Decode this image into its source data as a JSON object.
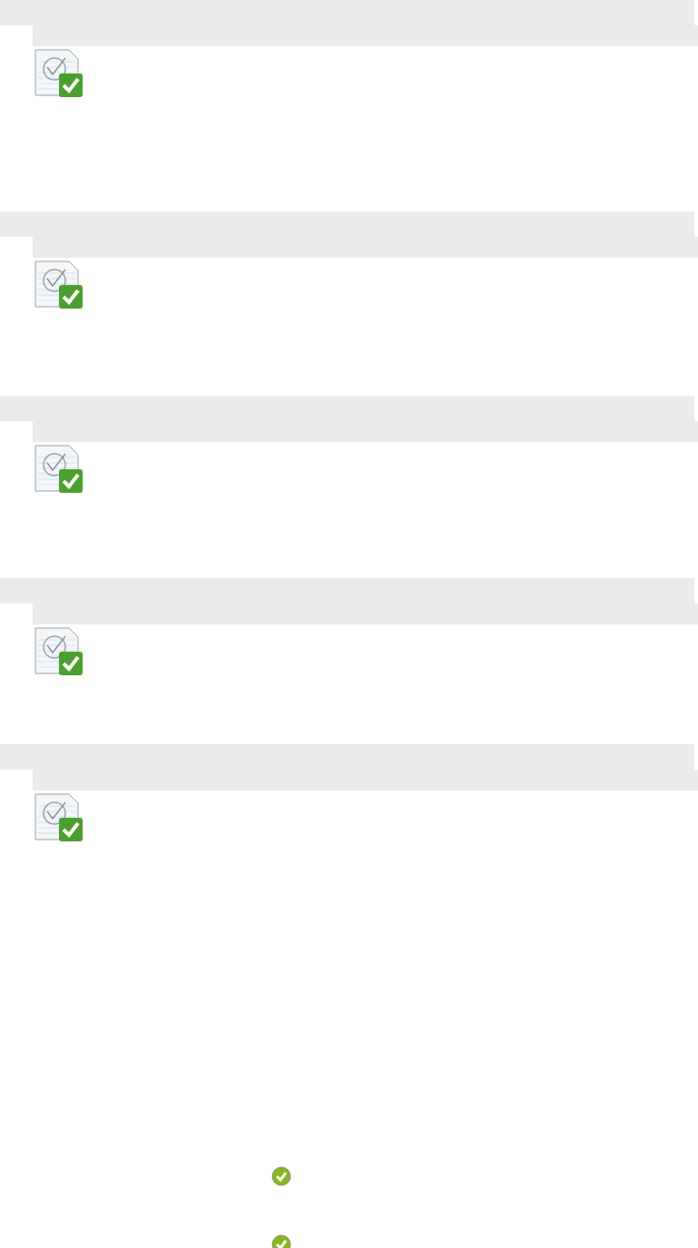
{
  "panels": [
    {
      "completed": true
    },
    {
      "completed": true
    },
    {
      "completed": true
    },
    {
      "completed": true
    },
    {
      "completed": true
    }
  ],
  "checks": [
    {
      "done": true
    },
    {
      "done": true
    }
  ]
}
